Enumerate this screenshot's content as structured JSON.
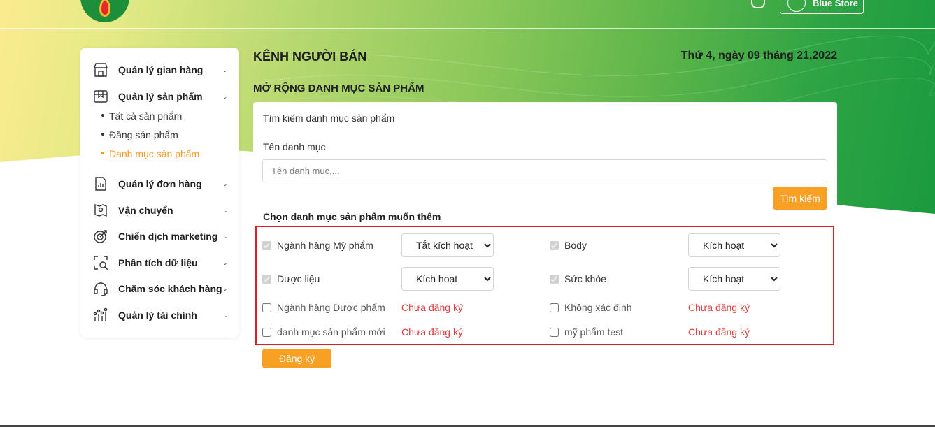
{
  "header": {
    "store_button_label": "Blue Store"
  },
  "sidebar": {
    "items": [
      {
        "label": "Quản lý gian hàng",
        "icon": "store-icon"
      },
      {
        "label": "Quản lý sản phẩm",
        "icon": "box-icon"
      },
      {
        "label": "Quản lý đơn hàng",
        "icon": "order-icon"
      },
      {
        "label": "Vận chuyển",
        "icon": "shipping-icon"
      },
      {
        "label": "Chiến dịch marketing",
        "icon": "target-icon"
      },
      {
        "label": "Phân tích dữ liệu",
        "icon": "analytics-icon"
      },
      {
        "label": "Chăm sóc khách hàng",
        "icon": "headset-icon"
      },
      {
        "label": "Quản lý tài chính",
        "icon": "finance-icon"
      }
    ],
    "subitems": [
      {
        "label": "Tất cả sản phẩm",
        "active": false
      },
      {
        "label": "Đăng sản phẩm",
        "active": false
      },
      {
        "label": "Danh mục sản phẩm",
        "active": true
      }
    ]
  },
  "main": {
    "title": "KÊNH NGƯỜI BÁN",
    "date": "Thứ 4, ngày 09 tháng 21,2022",
    "section_title": "MỞ RỘNG DANH MỤC SẢN PHẨM",
    "search": {
      "title": "Tìm kiếm danh mục sản phẩm",
      "field_label": "Tên danh mục",
      "placeholder": "Tên danh mục,...",
      "value": "",
      "button_label": "Tìm kiếm"
    },
    "choose_label": "Chọn danh mục sản phẩm muốn thêm",
    "categories": [
      {
        "name": "Ngành hàng Mỹ phẩm",
        "checked": true,
        "disabled": true,
        "status": "Tắt kích hoạt",
        "type": "select"
      },
      {
        "name": "Body",
        "checked": true,
        "disabled": true,
        "status": "Kích hoạt",
        "type": "select"
      },
      {
        "name": "Dược liệu",
        "checked": true,
        "disabled": true,
        "status": "Kích hoạt",
        "type": "select"
      },
      {
        "name": "Sức khỏe",
        "checked": true,
        "disabled": true,
        "status": "Kích hoạt",
        "type": "select"
      },
      {
        "name": "Ngành hàng Dược phẩm",
        "checked": false,
        "disabled": false,
        "status": "Chưa đăng ký",
        "type": "text"
      },
      {
        "name": "Không xác định",
        "checked": false,
        "disabled": false,
        "status": "Chưa đăng ký",
        "type": "text"
      },
      {
        "name": "danh mục sản phẩm mới",
        "checked": false,
        "disabled": false,
        "status": "Chưa đăng ký",
        "type": "text"
      },
      {
        "name": "mỹ phẩm test",
        "checked": false,
        "disabled": false,
        "status": "Chưa đăng ký",
        "type": "text"
      }
    ],
    "select_options": [
      "Kích hoạt",
      "Tắt kích hoạt"
    ],
    "register_button_label": "Đăng ký"
  },
  "colors": {
    "accent": "#f7a023",
    "active_menu": "#f49a1c",
    "unregistered": "#e13b3b",
    "highlight_border": "#e01e25"
  }
}
